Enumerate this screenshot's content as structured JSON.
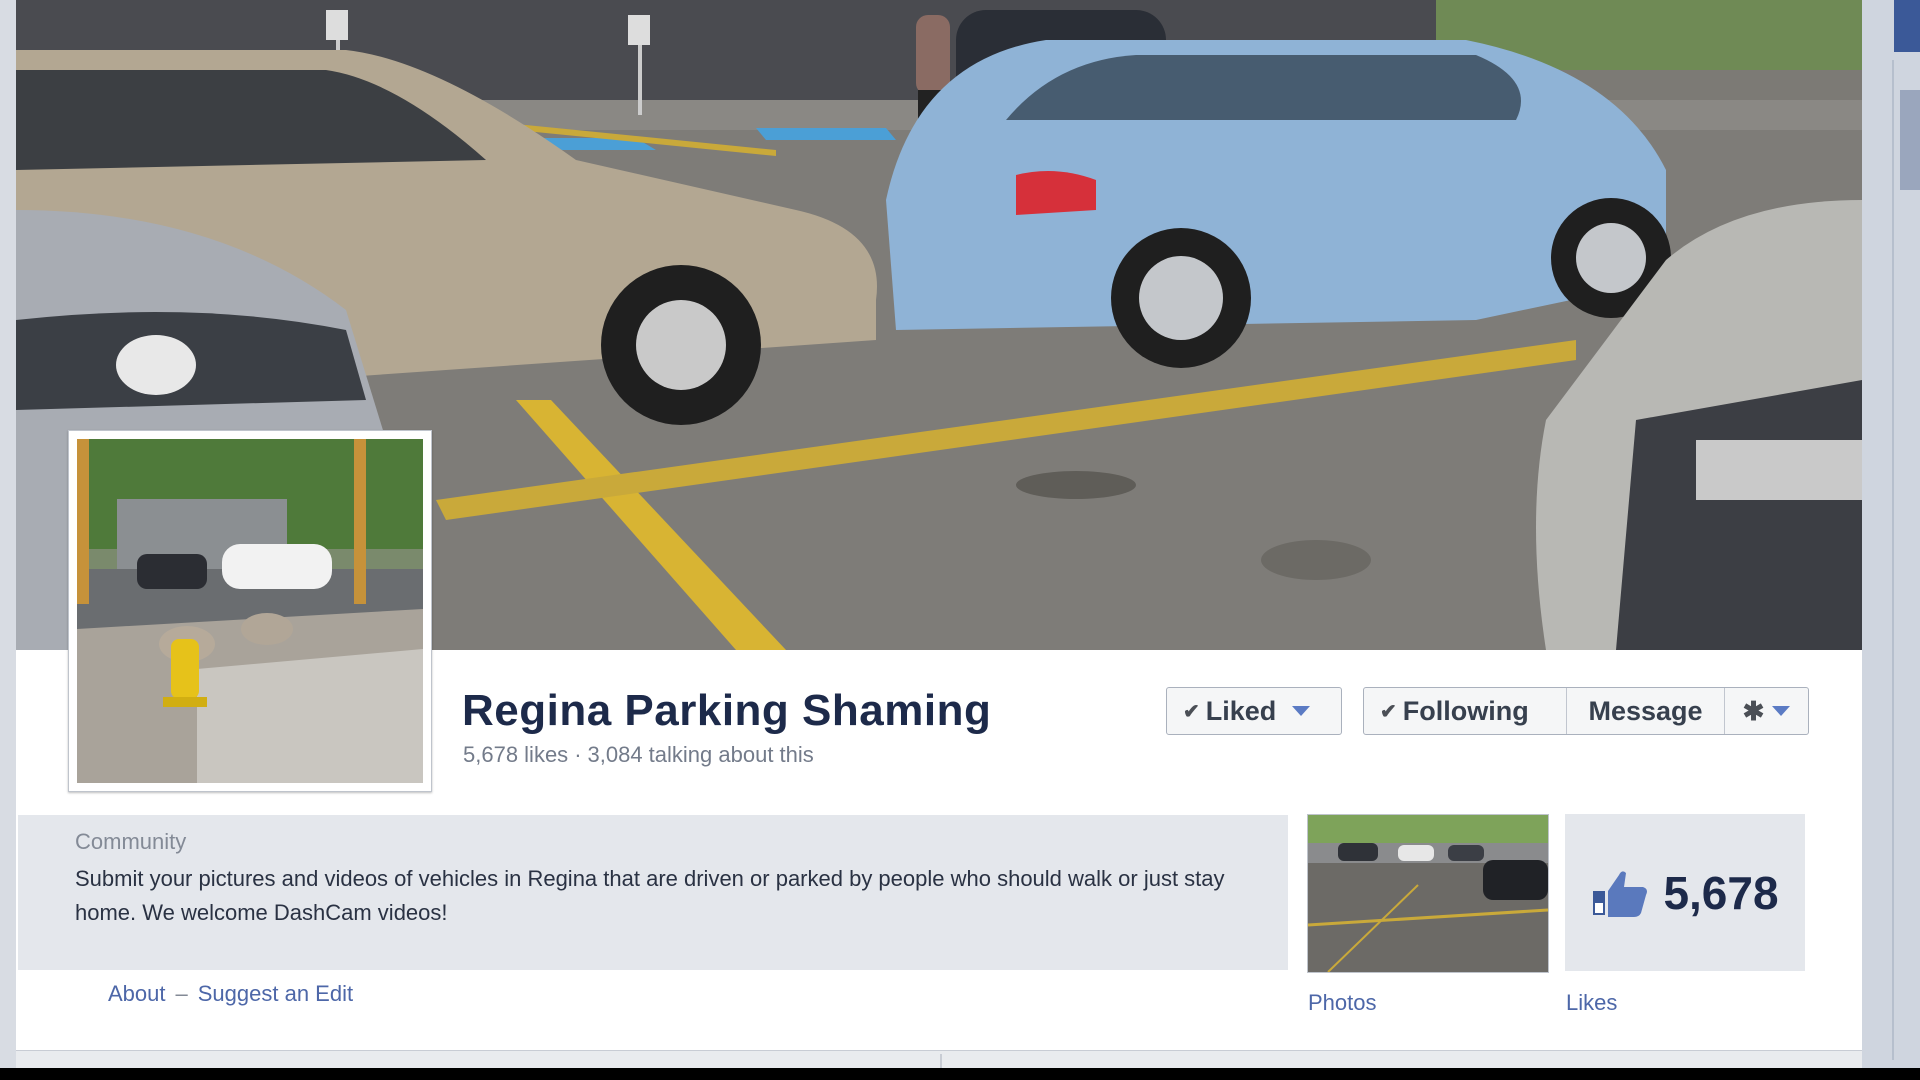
{
  "page": {
    "name": "Regina Parking Shaming",
    "likes_text": "5,678 likes",
    "separator": "·",
    "talking_text": "3,084 talking about this"
  },
  "actions": {
    "liked_label": "Liked",
    "following_label": "Following",
    "message_label": "Message"
  },
  "about": {
    "category": "Community",
    "description": "Submit your pictures and videos of vehicles in Regina that are driven or parked by people who should walk or just stay home. We welcome DashCam videos!",
    "about_link": "About",
    "dash": "–",
    "suggest_link": "Suggest an Edit"
  },
  "apps": {
    "photos_label": "Photos",
    "likes_count": "5,678",
    "likes_label": "Likes"
  },
  "icons": {
    "check": "check-icon",
    "caret": "caret-down-icon",
    "gear": "gear-icon",
    "thumb": "thumbs-up-icon"
  },
  "colors": {
    "brand": "#3b5998",
    "link": "#4d67a8",
    "title": "#1d2a4a"
  }
}
